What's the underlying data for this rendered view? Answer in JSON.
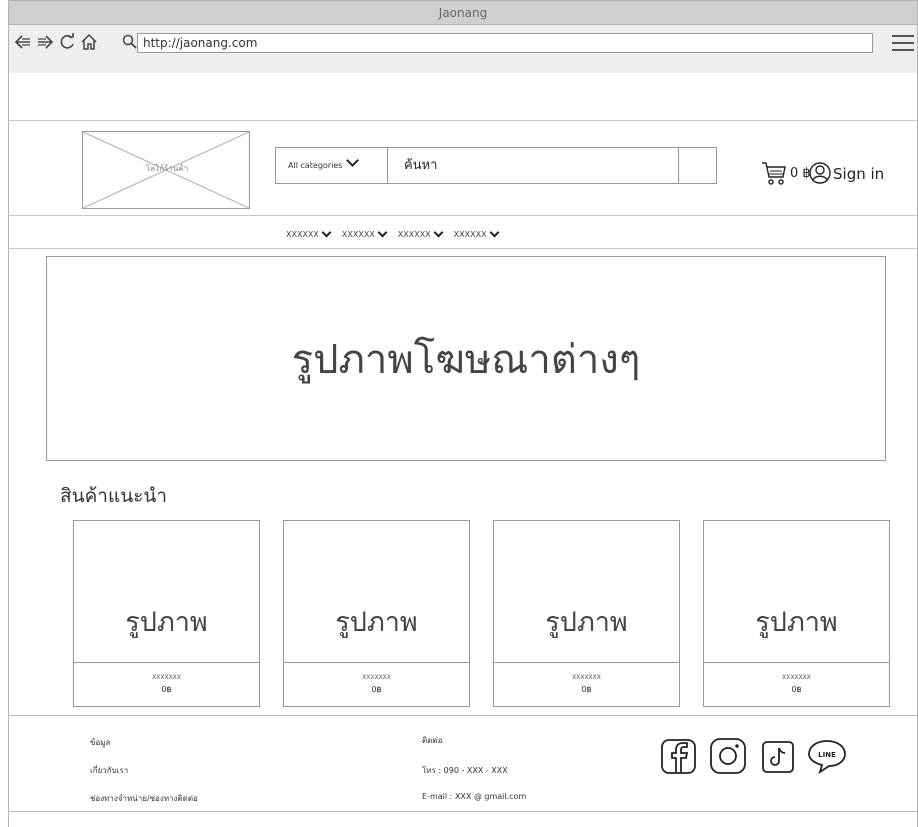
{
  "window": {
    "title": "Jaonang"
  },
  "toolbar": {
    "url": "http://jaonang.com"
  },
  "header": {
    "logo_text": "โลโก้ร้านค้า",
    "category_label": "All categories",
    "search_text": "ค้นหา",
    "cart_amount": "0 ฿",
    "signin_label": "Sign in"
  },
  "menu": {
    "items": [
      "XXXXXX",
      "XXXXXX",
      "XXXXXX",
      "XXXXXX"
    ]
  },
  "banner": {
    "text": "รูปภาพโฆษณาต่างๆ"
  },
  "recommended": {
    "title": "สินค้าแนะนำ",
    "products": [
      {
        "image_label": "รูปภาพ",
        "name": "XXXXXXX",
        "price": "0฿"
      },
      {
        "image_label": "รูปภาพ",
        "name": "XXXXXXX",
        "price": "0฿"
      },
      {
        "image_label": "รูปภาพ",
        "name": "XXXXXXX",
        "price": "0฿"
      },
      {
        "image_label": "รูปภาพ",
        "name": "XXXXXXX",
        "price": "0฿"
      }
    ]
  },
  "footer": {
    "info_heading": "ข้อมูล",
    "about_link": "เกี่ยวกับเรา",
    "channels_link": "ช่องทางจำหน่าย/ช่องทางติดต่อ",
    "contact_heading": "ติดต่อ",
    "phone": "โทร : 090 - XXX - XXX",
    "email": "E-mail : XXX @ gmail.com",
    "social_icons": [
      "facebook-icon",
      "instagram-icon",
      "tiktok-icon",
      "line-icon"
    ],
    "line_label": "LINE"
  }
}
